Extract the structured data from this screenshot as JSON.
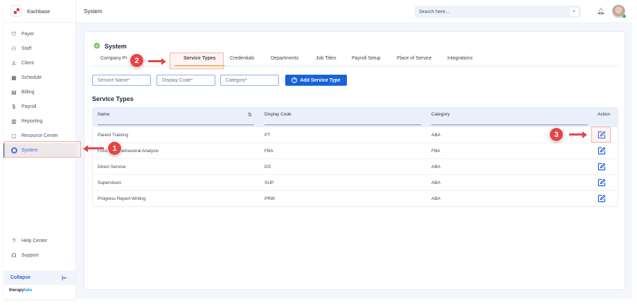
{
  "app": {
    "name": "Eachbase",
    "footer_brand_a": "therapy",
    "footer_brand_b": "lake"
  },
  "sidebar": {
    "items": [
      {
        "label": "Payer",
        "icon": "shield-icon"
      },
      {
        "label": "Staff",
        "icon": "users-icon"
      },
      {
        "label": "Client",
        "icon": "user-icon"
      },
      {
        "label": "Schedule",
        "icon": "calendar-icon"
      },
      {
        "label": "Billing",
        "icon": "billing-icon"
      },
      {
        "label": "Payroll",
        "icon": "payroll-icon"
      },
      {
        "label": "Reporting",
        "icon": "report-icon"
      },
      {
        "label": "Resource Center",
        "icon": "folder-icon"
      },
      {
        "label": "System",
        "icon": "system-icon",
        "active": true
      }
    ],
    "help": "Help Center",
    "support": "Support",
    "collapse": "Collapse"
  },
  "header": {
    "title": "System",
    "search_placeholder": "Search here..."
  },
  "page": {
    "title": "System",
    "tabs": [
      "Company Pr",
      "Service Types",
      "Credentials",
      "Departments",
      "Job Titles",
      "Payroll Setup",
      "Place of Service",
      "Integrations"
    ],
    "active_tab": "Service Types",
    "form": {
      "service_name_placeholder": "Service Name*",
      "display_code_placeholder": "Display Code*",
      "category_placeholder": "Category*",
      "add_button": "Add Service Type"
    },
    "section_title": "Service Types",
    "table": {
      "columns": [
        "Name",
        "Display Code",
        "Category",
        "Action"
      ],
      "rows": [
        {
          "name": "Parent Training",
          "code": "PT",
          "category": "ABA"
        },
        {
          "name": "Functional Behavioral Analysis",
          "code": "FBA",
          "category": "FBA"
        },
        {
          "name": "Direct Service",
          "code": "DS",
          "category": "ABA"
        },
        {
          "name": "Supervision",
          "code": "SUP",
          "category": "ABA"
        },
        {
          "name": "Progress Report Writing",
          "code": "PRW",
          "category": "ABA"
        }
      ]
    }
  },
  "annotations": [
    "1",
    "2",
    "3"
  ],
  "colors": {
    "accent": "#1762d8",
    "annotation": "#e54545",
    "tab_underline": "#f5b455",
    "gear": "#52b52a"
  }
}
